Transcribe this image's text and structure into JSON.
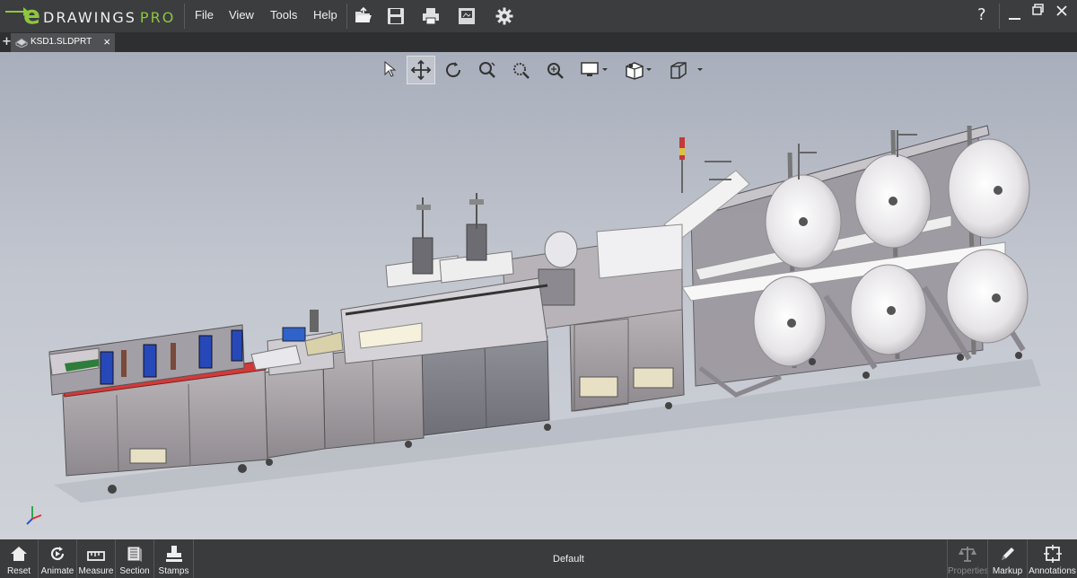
{
  "app": {
    "logo_e": "e",
    "logo_word": "DRAWINGS",
    "logo_suffix": "PRO",
    "help": "?"
  },
  "menu": {
    "file": "File",
    "view": "View",
    "tools": "Tools",
    "help": "Help"
  },
  "tab": {
    "title": "KSD1.SLDPRT",
    "close": "×",
    "add": "+"
  },
  "bottom": {
    "reset": "Reset",
    "animate": "Animate",
    "measure": "Measure",
    "section": "Section",
    "stamps": "Stamps",
    "config": "Default",
    "properties": "Properties",
    "markup": "Markup",
    "annotations": "Annotations"
  },
  "colors": {
    "accent": "#8dc63f",
    "titlebar": "#3c3d3f",
    "bottombar": "#3a3b3d"
  }
}
